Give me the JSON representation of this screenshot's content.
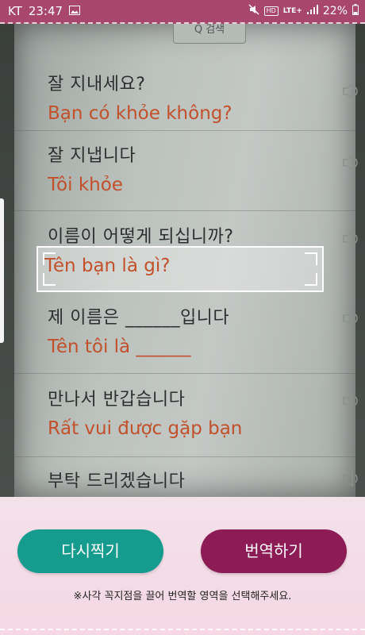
{
  "status_bar": {
    "carrier": "KT",
    "time": "23:47",
    "hd_label": "HD",
    "network": "LTE+",
    "battery": "22%"
  },
  "camera": {
    "search_tab_label": "Q 검색",
    "phrases": [
      {
        "korean": "잘 지내세요?",
        "vietnamese": "Bạn có khỏe không?"
      },
      {
        "korean": "잘 지냅니다",
        "vietnamese": "Tôi khỏe"
      },
      {
        "korean": "이름이 어떻게 되십니까?",
        "vietnamese": ""
      },
      {
        "korean": "제 이름은 ______입니다",
        "vietnamese": "Tên tôi là ______"
      },
      {
        "korean": "만나서 반갑습니다",
        "vietnamese": "Rất vui được gặp bạn"
      },
      {
        "korean": "부탁 드리겠습니다",
        "vietnamese": ""
      }
    ],
    "selection_text": "Tên bạn là gì?"
  },
  "actions": {
    "retake_label": "다시찍기",
    "translate_label": "번역하기",
    "retake_color": "#169b8f",
    "translate_color": "#8d1b55"
  },
  "hint": "※사각 꼭지점을 끌어 번역할 영역을 선택해주세요."
}
